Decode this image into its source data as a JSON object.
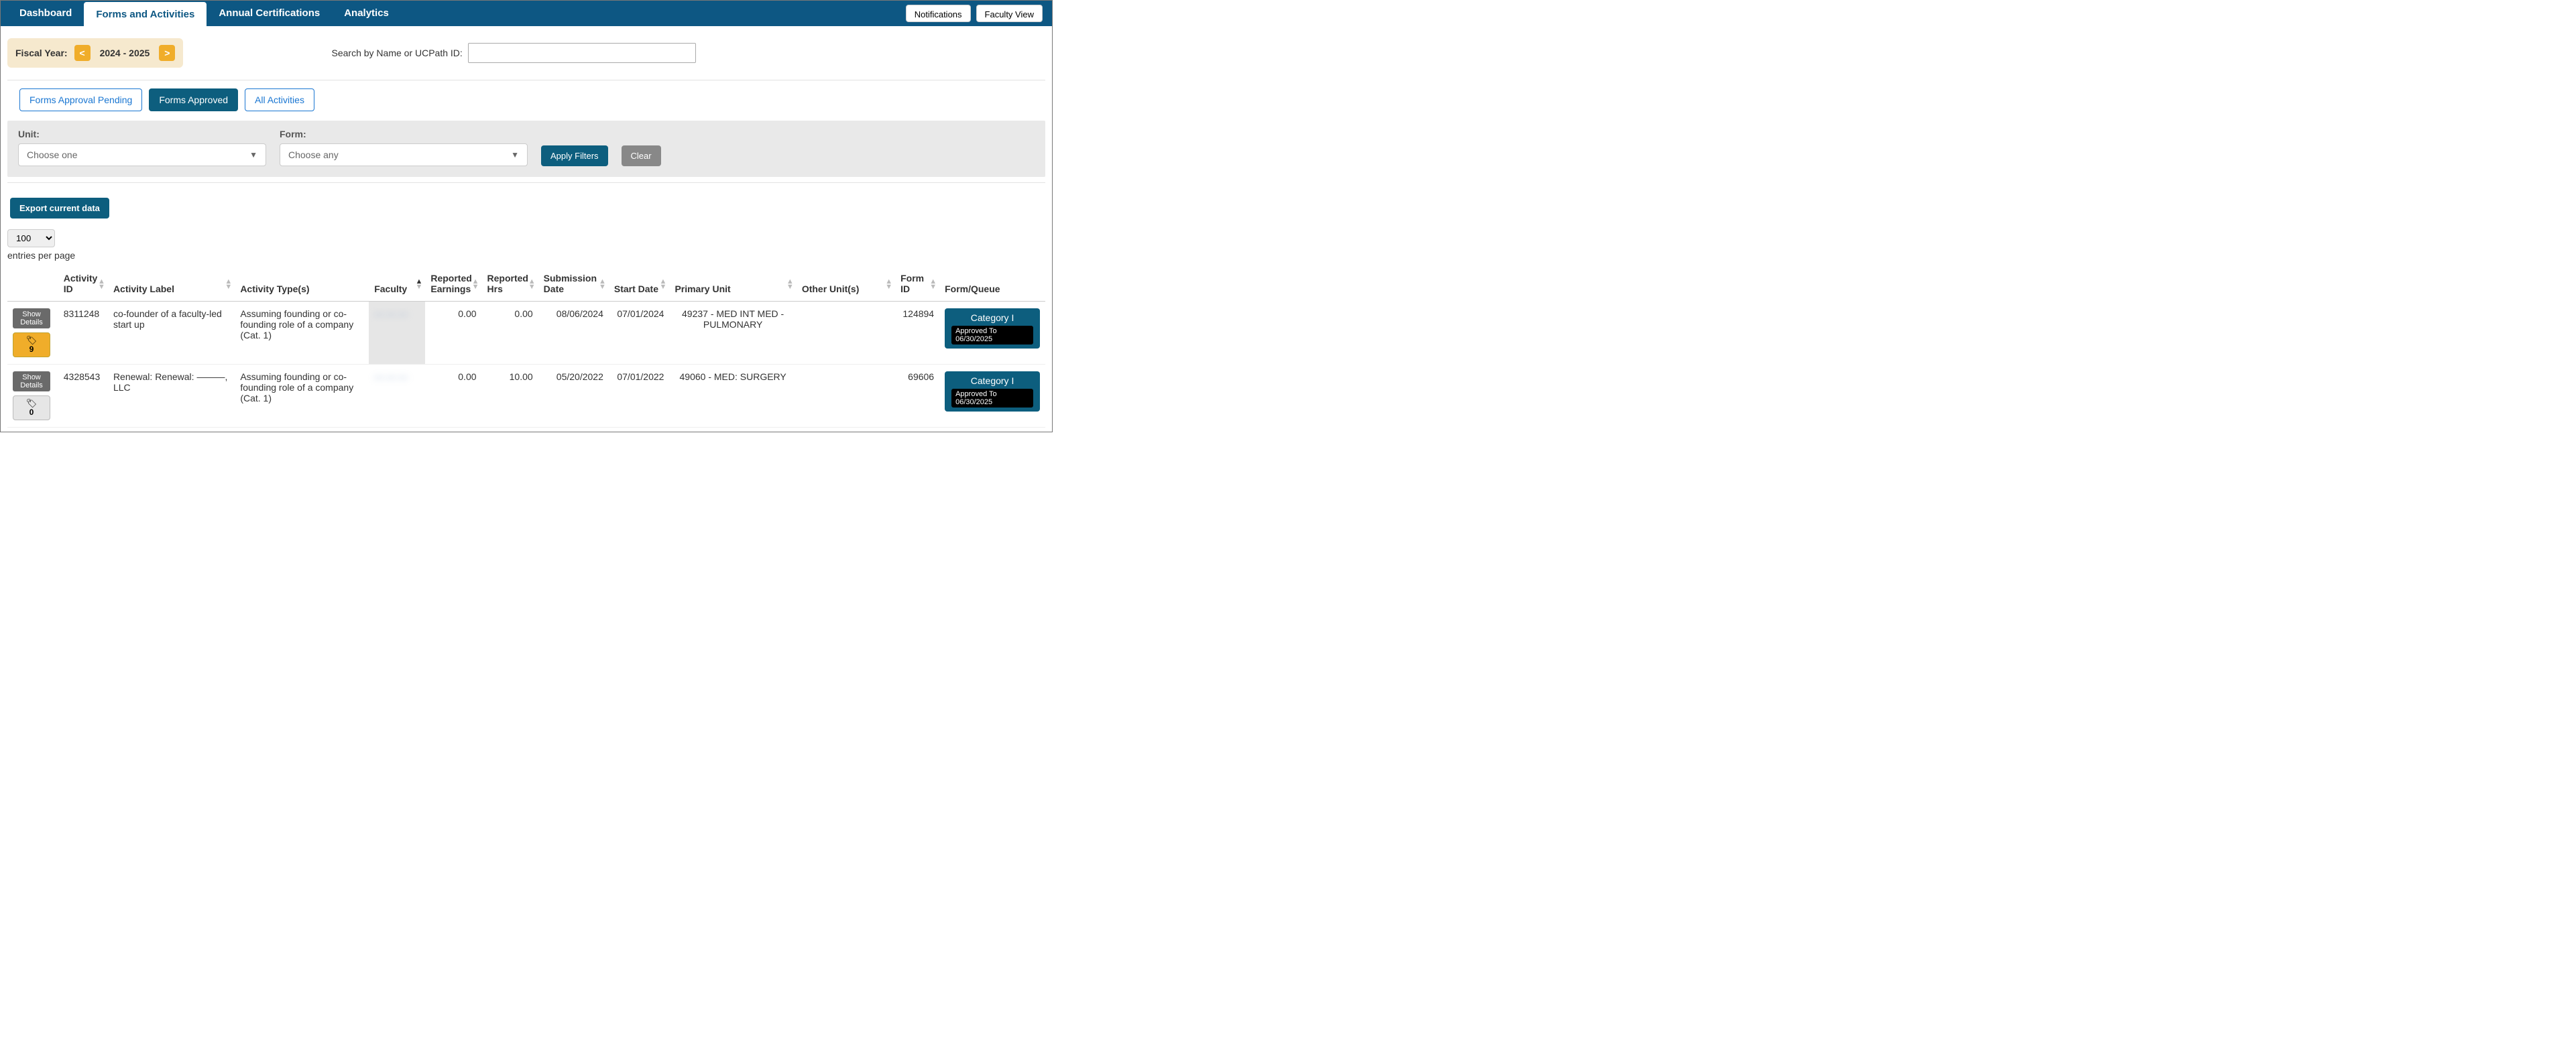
{
  "nav": {
    "tabs": [
      "Dashboard",
      "Forms and Activities",
      "Annual Certifications",
      "Analytics"
    ],
    "active": 1,
    "buttons": {
      "notifications": "Notifications",
      "faculty_view": "Faculty View"
    }
  },
  "fiscal_year": {
    "label": "Fiscal Year:",
    "prev": "<",
    "value": "2024 - 2025",
    "next": ">"
  },
  "search": {
    "label": "Search by Name or UCPath ID:",
    "value": ""
  },
  "subtabs": {
    "items": [
      "Forms Approval Pending",
      "Forms Approved",
      "All Activities"
    ],
    "active": 1
  },
  "filters": {
    "unit": {
      "label": "Unit:",
      "placeholder": "Choose one"
    },
    "form": {
      "label": "Form:",
      "placeholder": "Choose any"
    },
    "apply": "Apply Filters",
    "clear": "Clear"
  },
  "export_label": "Export current data",
  "pagesize": {
    "value": "100",
    "label": "entries per page"
  },
  "columns": {
    "actions": "",
    "activity_id": "Activity ID",
    "activity_label": "Activity Label",
    "activity_types": "Activity Type(s)",
    "faculty": "Faculty",
    "reported_earnings": "Reported Earnings",
    "reported_hrs": "Reported Hrs",
    "submission_date": "Submission Date",
    "start_date": "Start Date",
    "primary_unit": "Primary Unit",
    "other_units": "Other Unit(s)",
    "form_id": "Form ID",
    "form_queue": "Form/Queue"
  },
  "rows": [
    {
      "show_details": "Show Details",
      "attach_count": "9",
      "attach_style": "yellow",
      "activity_id": "8311248",
      "activity_label": "co-founder of a faculty-led start up",
      "activity_types": "Assuming founding or co-founding role of a company (Cat. 1)",
      "faculty": "— — —",
      "reported_earnings": "0.00",
      "reported_hrs": "0.00",
      "submission_date": "08/06/2024",
      "start_date": "07/01/2024",
      "primary_unit": "49237 - MED INT MED - PULMONARY",
      "other_units": "",
      "form_id": "124894",
      "queue_category": "Category I",
      "queue_status": "Approved To 06/30/2025"
    },
    {
      "show_details": "Show Details",
      "attach_count": "0",
      "attach_style": "grey",
      "activity_id": "4328543",
      "activity_label": "Renewal: Renewal: ———, LLC",
      "activity_types": "Assuming founding or co-founding role of a company (Cat. 1)",
      "faculty": "— — —",
      "reported_earnings": "0.00",
      "reported_hrs": "10.00",
      "submission_date": "05/20/2022",
      "start_date": "07/01/2022",
      "primary_unit": "49060 - MED: SURGERY",
      "other_units": "",
      "form_id": "69606",
      "queue_category": "Category I",
      "queue_status": "Approved To 06/30/2025"
    }
  ]
}
